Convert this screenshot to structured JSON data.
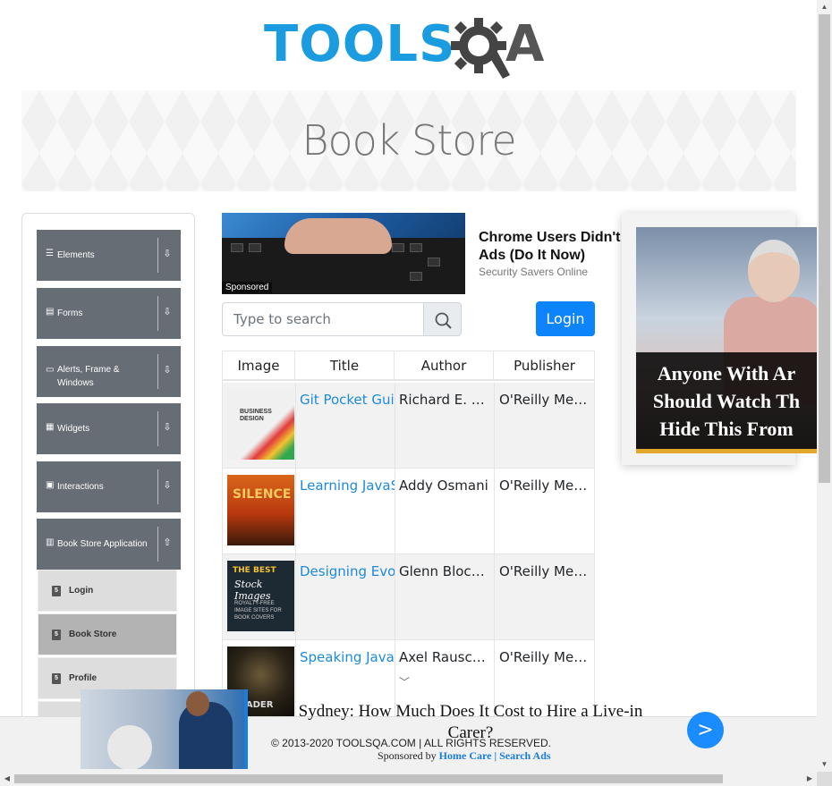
{
  "header": {
    "logo_left": "TOOLS",
    "logo_right": "A",
    "banner_title": "Book Store"
  },
  "sidebar": {
    "groups": [
      {
        "label": "Elements",
        "icon": "list-icon",
        "arrow": "⇩"
      },
      {
        "label": "Forms",
        "icon": "form-icon",
        "arrow": "⇩"
      },
      {
        "label": "Alerts, Frame & Windows",
        "icon": "window-icon",
        "arrow": "⇩"
      },
      {
        "label": "Widgets",
        "icon": "widgets-icon",
        "arrow": "⇩"
      },
      {
        "label": "Interactions",
        "icon": "interactions-icon",
        "arrow": "⇩"
      },
      {
        "label": "Book Store Application",
        "icon": "book-icon",
        "arrow": "⇧"
      }
    ],
    "items": [
      {
        "label": "Login",
        "icon": "html5-icon",
        "active": false
      },
      {
        "label": "Book Store",
        "icon": "html5-icon",
        "active": true
      },
      {
        "label": "Profile",
        "icon": "html5-icon",
        "active": false
      }
    ]
  },
  "ad_top": {
    "sponsored": "Sponsored",
    "title": "Chrome Users Didn't Ads (Do It Now)",
    "source": "Security Savers Online"
  },
  "search": {
    "placeholder": "Type to search",
    "login_label": "Login"
  },
  "table": {
    "headers": [
      "Image",
      "Title",
      "Author",
      "Publisher"
    ],
    "rows": [
      {
        "cover": "business-design-cover",
        "title": "Git Pocket Guide",
        "author": "Richard E. Silverman",
        "publisher": "O'Reilly Media"
      },
      {
        "cover": "silence-cover",
        "title": "Learning JavaScript Design Patterns",
        "author": "Addy Osmani",
        "publisher": "O'Reilly Media"
      },
      {
        "cover": "best-stock-images-cover",
        "title": "Designing Evolvable Web APIs with ASP.NET",
        "author": "Glenn Block et al.",
        "publisher": "O'Reilly Media"
      },
      {
        "cover": "leader-cover",
        "title": "Speaking JavaScript",
        "author": "Axel Rauschmayer",
        "publisher": "O'Reilly Media"
      }
    ]
  },
  "ad_right": {
    "lines": [
      "Anyone With Ar",
      "Should Watch Th",
      "Hide This From"
    ]
  },
  "footer": {
    "copyright": "© 2013-2020 TOOLSQA.COM | ALL RIGHTS RESERVED."
  },
  "ad_bottom": {
    "title": "Sydney: How Much Does It Cost to Hire a Live-in Carer?",
    "sponsor_prefix": "Sponsored by",
    "sponsor_link1": "Home Care",
    "sponsor_sep": "|",
    "sponsor_link2": "Search Ads",
    "next_label": ">"
  },
  "colors": {
    "logo_blue": "#1b9be0",
    "sidebar_group": "#666d75",
    "login_blue": "#0d84fa",
    "link_blue": "#1d8ada"
  }
}
